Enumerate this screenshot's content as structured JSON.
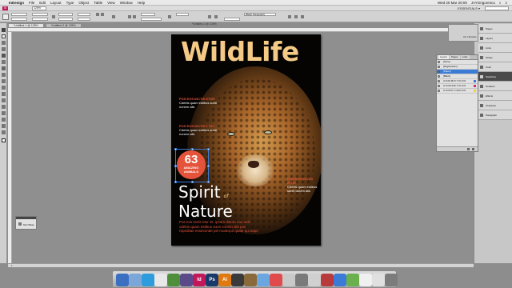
{
  "menubar": {
    "items": [
      "InDesign",
      "File",
      "Edit",
      "Layout",
      "Type",
      "Object",
      "Table",
      "View",
      "Window",
      "Help"
    ],
    "clock": "Wed 20 Mar 20:00",
    "user": "JAYGrigorescu"
  },
  "appbar": {
    "zoom": "125%",
    "workspace": "ESSENTIALS ▾"
  },
  "control": {
    "paragraph_style": "[Basic Paragraph]"
  },
  "document": {
    "tabs": [
      "*Untitled-1 @ 125%",
      "*Untitled-2 @ 125%"
    ],
    "window_title": "*Untitled-1 @ 125%",
    "status": "1"
  },
  "magazine": {
    "masthead": "WildLife",
    "kickers": [
      {
        "head": "POS EOS INCTIS ETUR",
        "body": "Cdebis quam estibus sunti nonem alis"
      },
      {
        "head": "POS EOS INCTIS ETUR",
        "body": "Cdebis quam estibus sunti nonem alis"
      }
    ],
    "badge_number": "63",
    "badge_text": "AMAZING ANIMALS",
    "headline_line1": "Spirit",
    "headline_of": "of",
    "headline_line2": "Nature",
    "right_kicker": {
      "head": "POS EOS INCTIS ETUR",
      "body": "Cdebis quam estibus sunti nonem alis"
    },
    "deck": "Pos eos inctis etur sit, ipsum dolore non velit cdebis quam estibus sunti nonem alis pos repeditae essinomde pel modicipit quate qui aspe"
  },
  "panels": {
    "cc_label": "CC Libraries",
    "collapsed": [
      "Pages",
      "Layers",
      "Links",
      "Stroke",
      "Color",
      "Swatches",
      "Gradient",
      "Effects",
      "Character",
      "Paragraph"
    ],
    "layers_tabs": [
      "Layers",
      "Pages",
      "Links"
    ],
    "layers_rows": [
      "[None]",
      "[Registration]",
      "[Paper]",
      "[Black]",
      "C=100 M=0 Y=0 K=0",
      "C=0 M=100 Y=0 K=0",
      "C=0 M=0 Y=100 K=0"
    ],
    "float_label": "Text Wrap"
  },
  "dock": {
    "apps": [
      {
        "label": "",
        "color": "#3b6fc2"
      },
      {
        "label": "",
        "color": "#7aa7d8"
      },
      {
        "label": "",
        "color": "#2e9bdc"
      },
      {
        "label": "",
        "color": "#e8e8e8"
      },
      {
        "label": "",
        "color": "#4e8f3b"
      },
      {
        "label": "",
        "color": "#5a4a8a"
      },
      {
        "label": "Id",
        "color": "#c2185b"
      },
      {
        "label": "Ps",
        "color": "#1a3a6b"
      },
      {
        "label": "Ai",
        "color": "#e07a10"
      },
      {
        "label": "",
        "color": "#3a3a3a"
      },
      {
        "label": "",
        "color": "#8a6a3a"
      },
      {
        "label": "",
        "color": "#6aa6e0"
      },
      {
        "label": "",
        "color": "#e04a4a"
      },
      {
        "label": "",
        "color": "#c9c9c9"
      },
      {
        "label": "",
        "color": "#7a7a7a"
      },
      {
        "label": "",
        "color": "#d0d0d0"
      },
      {
        "label": "",
        "color": "#b93a3a"
      },
      {
        "label": "",
        "color": "#3b7bd5"
      },
      {
        "label": "",
        "color": "#6ab04c"
      },
      {
        "label": "",
        "color": "#f0f0f0"
      },
      {
        "label": "",
        "color": "#e0e0e0"
      },
      {
        "label": "",
        "color": "#7c7c7c"
      }
    ]
  }
}
